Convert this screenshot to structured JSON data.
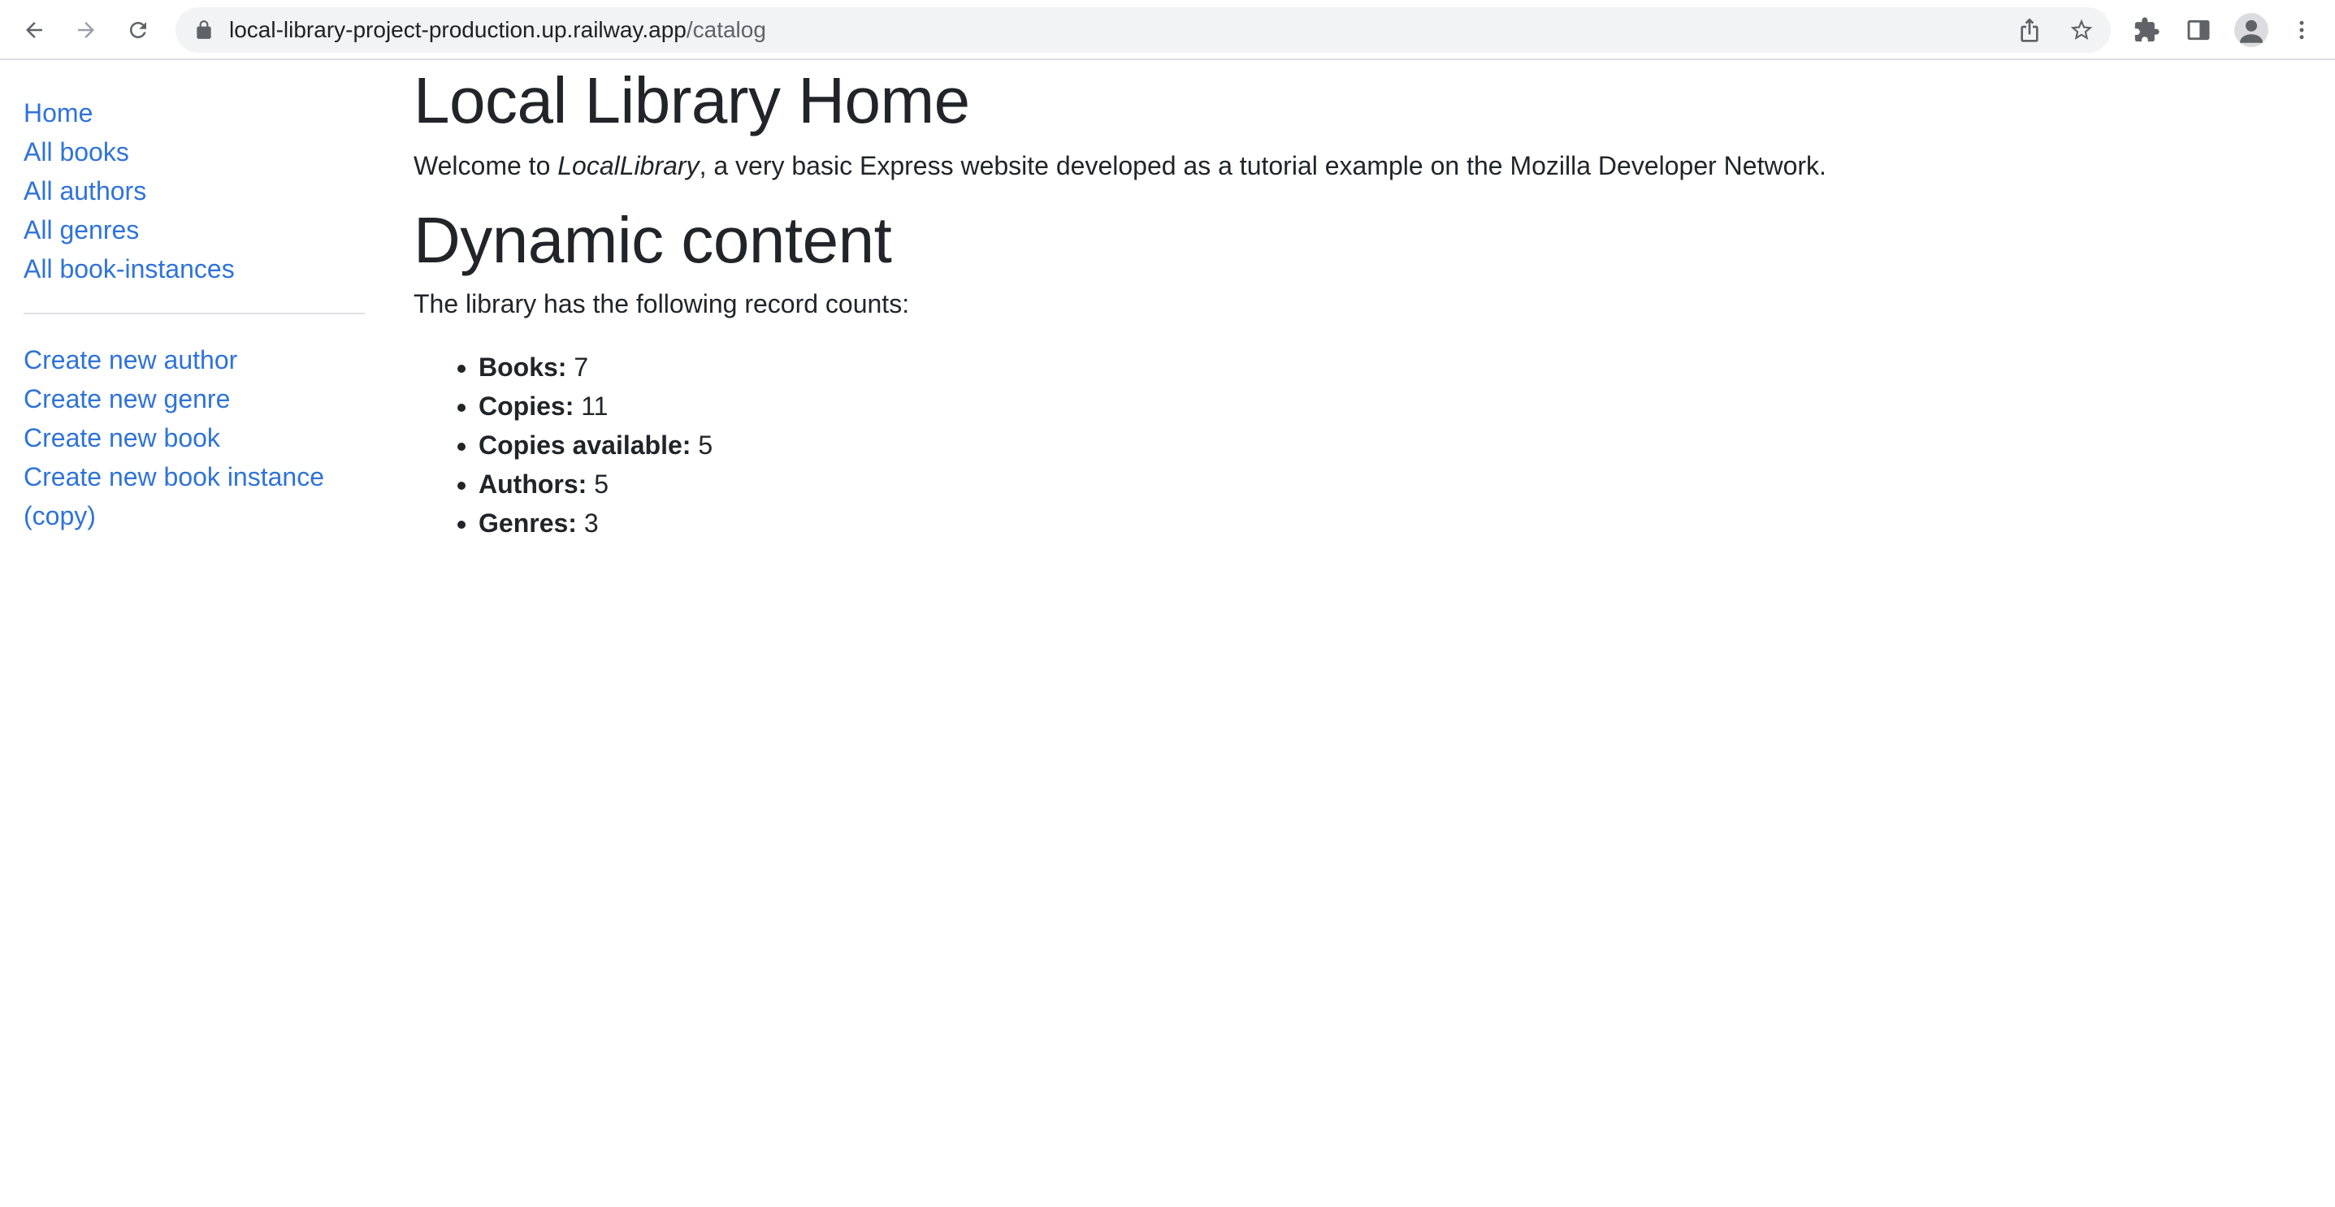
{
  "browser": {
    "url_host": "local-library-project-production.up.railway.app",
    "url_path": "/catalog"
  },
  "sidebar": {
    "links": [
      {
        "label": "Home"
      },
      {
        "label": "All books"
      },
      {
        "label": "All authors"
      },
      {
        "label": "All genres"
      },
      {
        "label": "All book-instances"
      }
    ],
    "create_links": [
      {
        "label": "Create new author"
      },
      {
        "label": "Create new genre"
      },
      {
        "label": "Create new book"
      },
      {
        "label": "Create new book instance (copy)"
      }
    ]
  },
  "main": {
    "title": "Local Library Home",
    "welcome_prefix": "Welcome to ",
    "welcome_brand": "LocalLibrary",
    "welcome_suffix": ", a very basic Express website developed as a tutorial example on the Mozilla Developer Network.",
    "dynamic_heading": "Dynamic content",
    "counts_intro": "The library has the following record counts:",
    "counts": [
      {
        "label": "Books:",
        "value": "7"
      },
      {
        "label": "Copies:",
        "value": "11"
      },
      {
        "label": "Copies available:",
        "value": "5"
      },
      {
        "label": "Authors:",
        "value": "5"
      },
      {
        "label": "Genres:",
        "value": "3"
      }
    ]
  },
  "icons": {
    "back": "back-arrow-icon",
    "forward": "forward-arrow-icon",
    "reload": "reload-icon",
    "lock": "lock-icon",
    "share": "share-icon",
    "bookmark": "star-icon",
    "extensions": "puzzle-icon",
    "side_panel": "side-panel-icon",
    "profile": "profile-avatar-icon",
    "menu": "kebab-menu-icon"
  },
  "colors": {
    "link": "#2f73d9",
    "text": "#212529",
    "omnibox_bg": "#f1f3f4"
  }
}
